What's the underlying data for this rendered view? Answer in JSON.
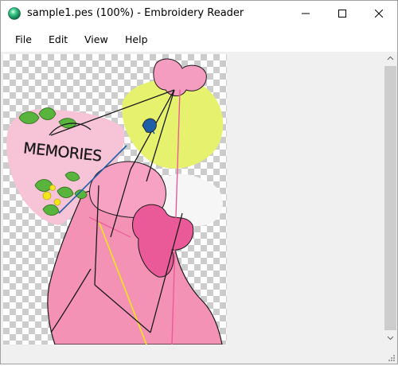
{
  "window": {
    "title": "sample1.pes (100%) - Embroidery Reader",
    "app_icon": "green-sphere-icon",
    "controls": [
      "minimize-icon",
      "maximize-icon",
      "close-icon"
    ]
  },
  "menu": {
    "items": [
      {
        "label": "File"
      },
      {
        "label": "Edit"
      },
      {
        "label": "View"
      },
      {
        "label": "Help"
      }
    ]
  },
  "design": {
    "text": "MEMORIES",
    "thread_colors": [
      "#f5a3c7",
      "#ea5a98",
      "#e6f26e",
      "#58b43c",
      "#f2e51c",
      "#1f5fa8",
      "#1a1a1a"
    ]
  },
  "scrollbars": {
    "vertical": "visible",
    "horizontal": "empty"
  },
  "colors": {
    "checker_light": "#ffffff",
    "checker_dark": "#cccccc",
    "chrome": "#f0f0f0"
  }
}
